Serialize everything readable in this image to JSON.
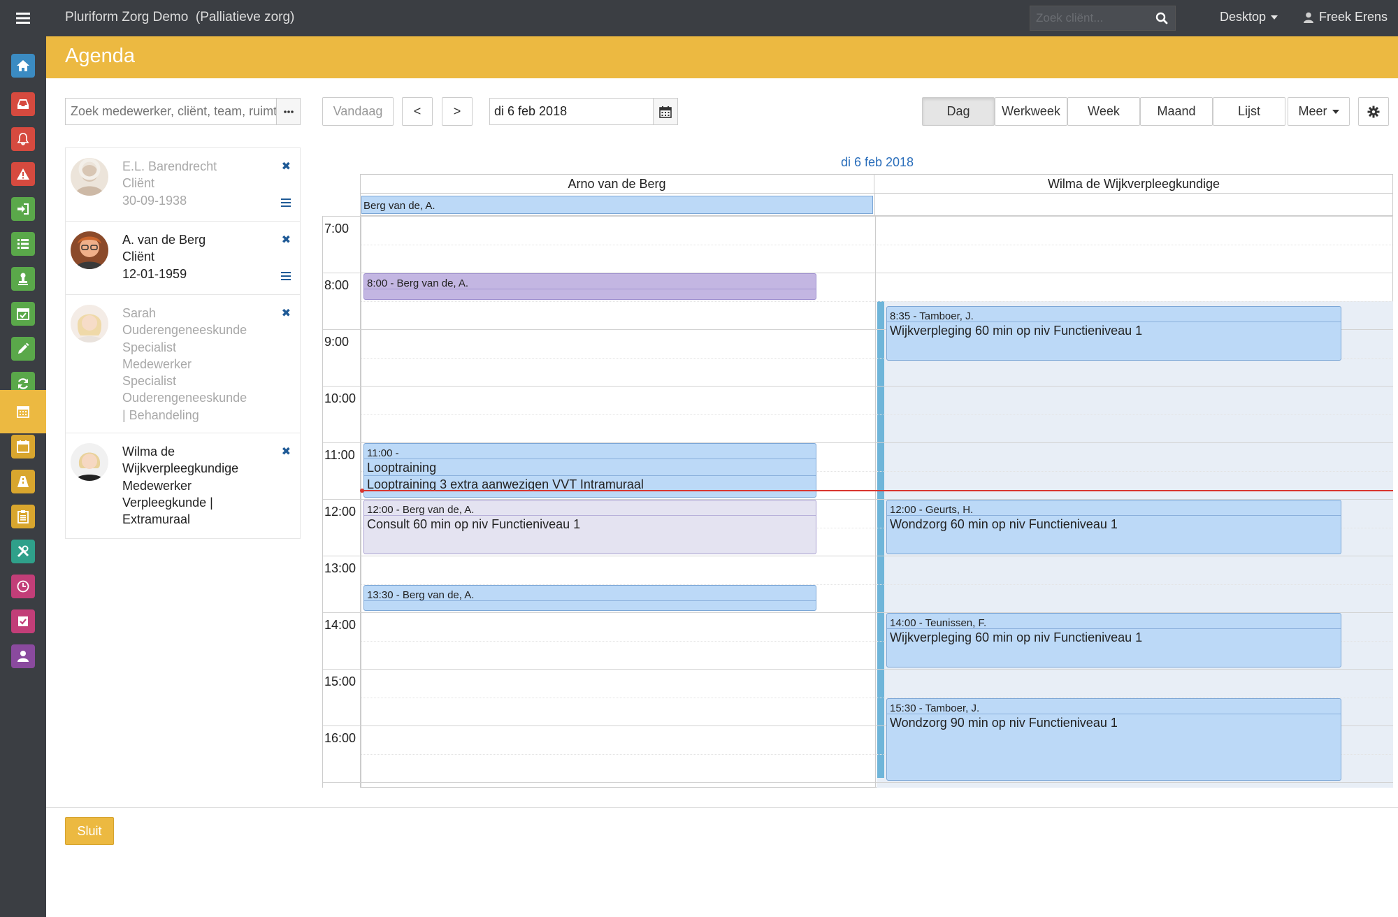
{
  "app": {
    "title": "Pluriform Zorg Demo",
    "subtitle": "(Palliatieve zorg)",
    "search_placeholder": "Zoek cliënt...",
    "desktop_label": "Desktop",
    "user_name": "Freek Erens",
    "accent_color": "#ecb941"
  },
  "rail": [
    {
      "name": "home-icon",
      "color": "#3b8bc2"
    },
    {
      "name": "inbox-icon",
      "color": "#d64a3f"
    },
    {
      "name": "bell-icon",
      "color": "#d64a3f"
    },
    {
      "name": "warning-icon",
      "color": "#d64a3f"
    },
    {
      "name": "sign-in-icon",
      "color": "#5aa84a"
    },
    {
      "name": "list-icon",
      "color": "#5aa84a"
    },
    {
      "name": "person-stamp-icon",
      "color": "#5aa84a"
    },
    {
      "name": "calendar-check-icon",
      "color": "#5aa84a"
    },
    {
      "name": "pencil-icon",
      "color": "#5aa84a"
    },
    {
      "name": "refresh-icon",
      "color": "#5aa84a"
    },
    {
      "name": "calendar-icon",
      "color": "#ecb941",
      "active": true
    },
    {
      "name": "calendar-blank-icon",
      "color": "#d9a62e"
    },
    {
      "name": "road-icon",
      "color": "#d9a62e"
    },
    {
      "name": "clipboard-icon",
      "color": "#d9a62e"
    },
    {
      "name": "tools-icon",
      "color": "#2fa08a"
    },
    {
      "name": "clock-icon",
      "color": "#c23e78"
    },
    {
      "name": "checkbox-icon",
      "color": "#c23e78"
    },
    {
      "name": "user-icon",
      "color": "#8a4a9e"
    }
  ],
  "page": {
    "title": "Agenda"
  },
  "people_search": {
    "placeholder": "Zoek medewerker, cliënt, team, ruimte",
    "value": ""
  },
  "people": [
    {
      "lines": [
        "E.L. Barendrecht",
        "Cliënt",
        "30-09-1938"
      ],
      "dimmed": true,
      "has_menu": true
    },
    {
      "lines": [
        "A. van de Berg",
        "Cliënt",
        "12-01-1959"
      ],
      "dimmed": false,
      "has_menu": true
    },
    {
      "lines": [
        "Sarah",
        "Ouderengeneeskunde",
        "Specialist",
        "Medewerker",
        "Specialist",
        "Ouderengeneeskunde",
        "| Behandeling"
      ],
      "dimmed": true,
      "has_menu": false
    },
    {
      "lines": [
        "Wilma de",
        "Wijkverpleegkundige",
        "Medewerker",
        "Verpleegkunde |",
        "Extramuraal"
      ],
      "dimmed": false,
      "has_menu": false
    }
  ],
  "toolbar": {
    "today": "Vandaag",
    "prev": "<",
    "next": ">",
    "date_value": "di 6 feb 2018",
    "views": [
      "Dag",
      "Werkweek",
      "Week",
      "Maand",
      "Lijst"
    ],
    "active_view": "Dag",
    "more": "Meer"
  },
  "calendar": {
    "date_label": "di 6 feb 2018",
    "resources": [
      "Arno van de Berg",
      "Wilma de Wijkverpleegkundige"
    ],
    "allday_event": "Berg van de, A.",
    "hours": [
      "7:00",
      "8:00",
      "9:00",
      "10:00",
      "11:00",
      "12:00",
      "13:00",
      "14:00",
      "15:00",
      "16:00"
    ],
    "now_time": "11:50",
    "events": [
      {
        "resource": 0,
        "start": "8:00",
        "end": "8:30",
        "time_line": "8:00 - Berg van de, A.",
        "title": "",
        "style": "purple"
      },
      {
        "resource": 0,
        "start": "11:00",
        "end": "12:00",
        "time_line": "11:00 -",
        "title": "Looptraining",
        "sub": "Looptraining 3 extra aanwezigen VVT Intramuraal",
        "style": "blue"
      },
      {
        "resource": 0,
        "start": "12:00",
        "end": "13:00",
        "time_line": "12:00 - Berg van de, A.",
        "title": "Consult 60 min op niv Functieniveau 1",
        "style": "lavender"
      },
      {
        "resource": 0,
        "start": "13:30",
        "end": "14:00",
        "time_line": "13:30 - Berg van de, A.",
        "title": "",
        "style": "blue"
      },
      {
        "resource": 1,
        "start": "8:35",
        "end": "9:35",
        "time_line": "8:35 - Tamboer, J.",
        "title": "Wijkverpleging 60 min op niv Functieniveau 1",
        "style": "blue"
      },
      {
        "resource": 1,
        "start": "12:00",
        "end": "13:00",
        "time_line": "12:00 - Geurts, H.",
        "title": "Wondzorg 60 min op niv Functieniveau 1",
        "style": "blue"
      },
      {
        "resource": 1,
        "start": "14:00",
        "end": "15:00",
        "time_line": "14:00 - Teunissen, F.",
        "title": "Wijkverpleging 60 min op niv Functieniveau 1",
        "style": "blue"
      },
      {
        "resource": 1,
        "start": "15:30",
        "end": "17:00",
        "time_line": "15:30 - Tamboer, J.",
        "title": "Wondzorg 90 min op niv Functieniveau 1",
        "style": "blue"
      }
    ]
  },
  "footer": {
    "close_label": "Sluit"
  }
}
